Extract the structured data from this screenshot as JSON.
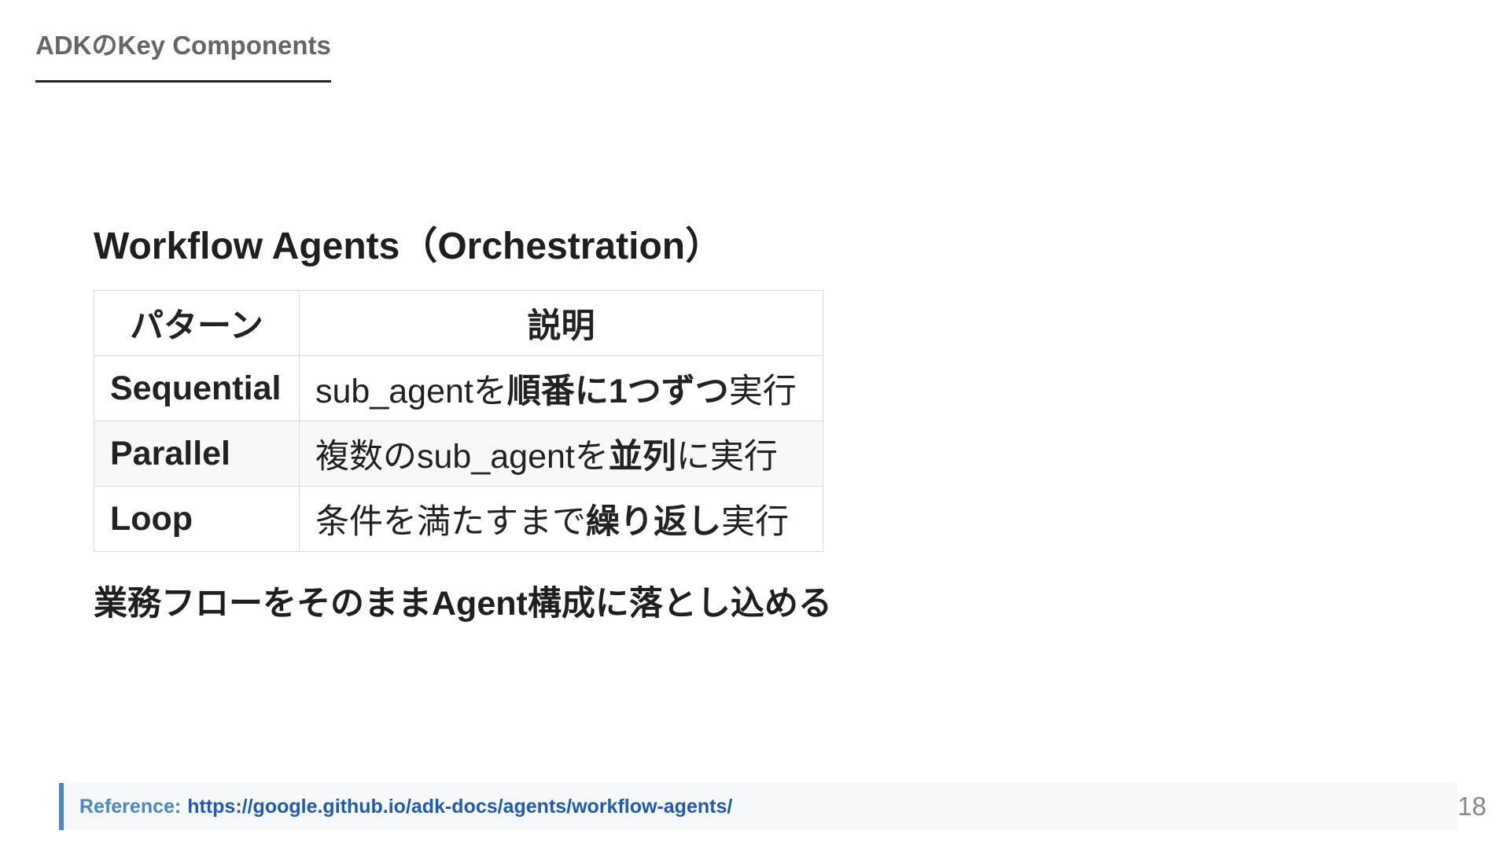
{
  "header": {
    "title": "ADKのKey Components"
  },
  "section": {
    "title": "Workflow Agents（Orchestration）"
  },
  "table": {
    "headers": [
      "パターン",
      "説明"
    ],
    "rows": [
      {
        "name": "Sequential",
        "desc": [
          {
            "text": "sub_agentを",
            "bold": false
          },
          {
            "text": "順番に1つずつ",
            "bold": true
          },
          {
            "text": "実行",
            "bold": false
          }
        ]
      },
      {
        "name": "Parallel",
        "desc": [
          {
            "text": "複数のsub_agentを",
            "bold": false
          },
          {
            "text": "並列",
            "bold": true
          },
          {
            "text": "に実行",
            "bold": false
          }
        ]
      },
      {
        "name": "Loop",
        "desc": [
          {
            "text": "条件を満たすまで",
            "bold": false
          },
          {
            "text": "繰り返し",
            "bold": true
          },
          {
            "text": "実行",
            "bold": false
          }
        ]
      }
    ]
  },
  "summary": {
    "text": "業務フローをそのままAgent構成に落とし込める"
  },
  "reference": {
    "label": "Reference:",
    "url": "https://google.github.io/adk-docs/agents/workflow-agents/"
  },
  "page_number": "18",
  "colors": {
    "accent": "#4a86c8",
    "link": "#1f5ab3",
    "header_text": "#666666"
  }
}
